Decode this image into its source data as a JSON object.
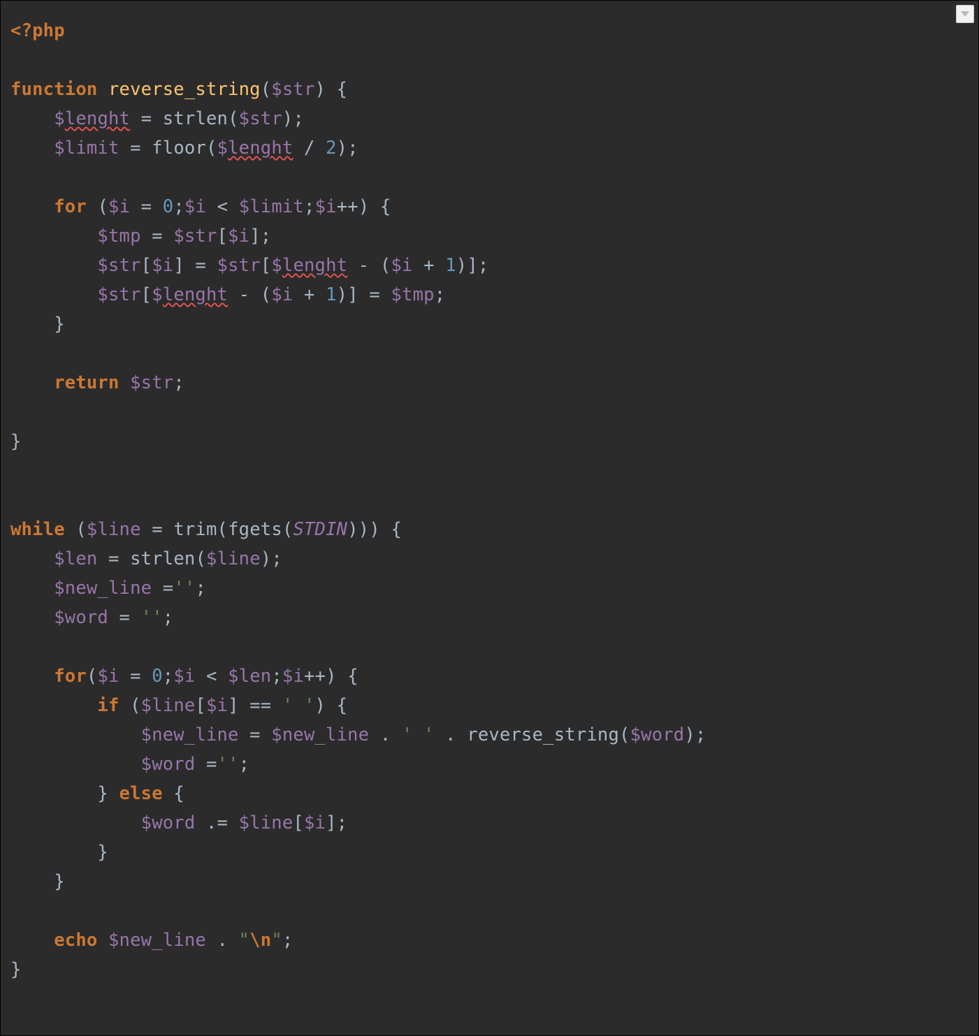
{
  "tokens": {
    "php_open": "<?php",
    "kw_function": "function",
    "fn_name": "reverse_string",
    "var_str": "$str",
    "var_lenght_full": "$lenght",
    "var_lenght_prefix": "$",
    "var_lenght_word": "lenght",
    "call_strlen": "strlen",
    "var_limit": "$limit",
    "call_floor": "floor",
    "num_2": "2",
    "kw_for": "for",
    "var_i": "$i",
    "num_0": "0",
    "var_tmp": "$tmp",
    "num_1": "1",
    "kw_return": "return",
    "kw_while": "while",
    "var_line": "$line",
    "call_trim": "trim",
    "call_fgets": "fgets",
    "const_stdin": "STDIN",
    "var_len": "$len",
    "var_new_line": "$new_line",
    "str_empty": "''",
    "var_word": "$word",
    "kw_if": "if",
    "str_space": "' '",
    "call_reverse": "reverse_string",
    "kw_else": "else",
    "kw_echo": "echo",
    "str_nl_open": "\"",
    "str_nl_body": "\\n",
    "str_nl_close": "\"",
    "p_open": "(",
    "p_close": ")",
    "b_open": "{",
    "b_close": "}",
    "sq_open": "[",
    "sq_close": "]",
    "semi": ";",
    "assign": " = ",
    "slash": " / ",
    "lt": " < ",
    "pp": "++",
    "minus": " - ",
    "plus": " + ",
    "eqeq": " == ",
    "dot": " . ",
    "dot_eq": " .= ",
    "assign_tight": "=",
    "space": " "
  },
  "icon": {
    "name": "chevron-down-icon"
  }
}
